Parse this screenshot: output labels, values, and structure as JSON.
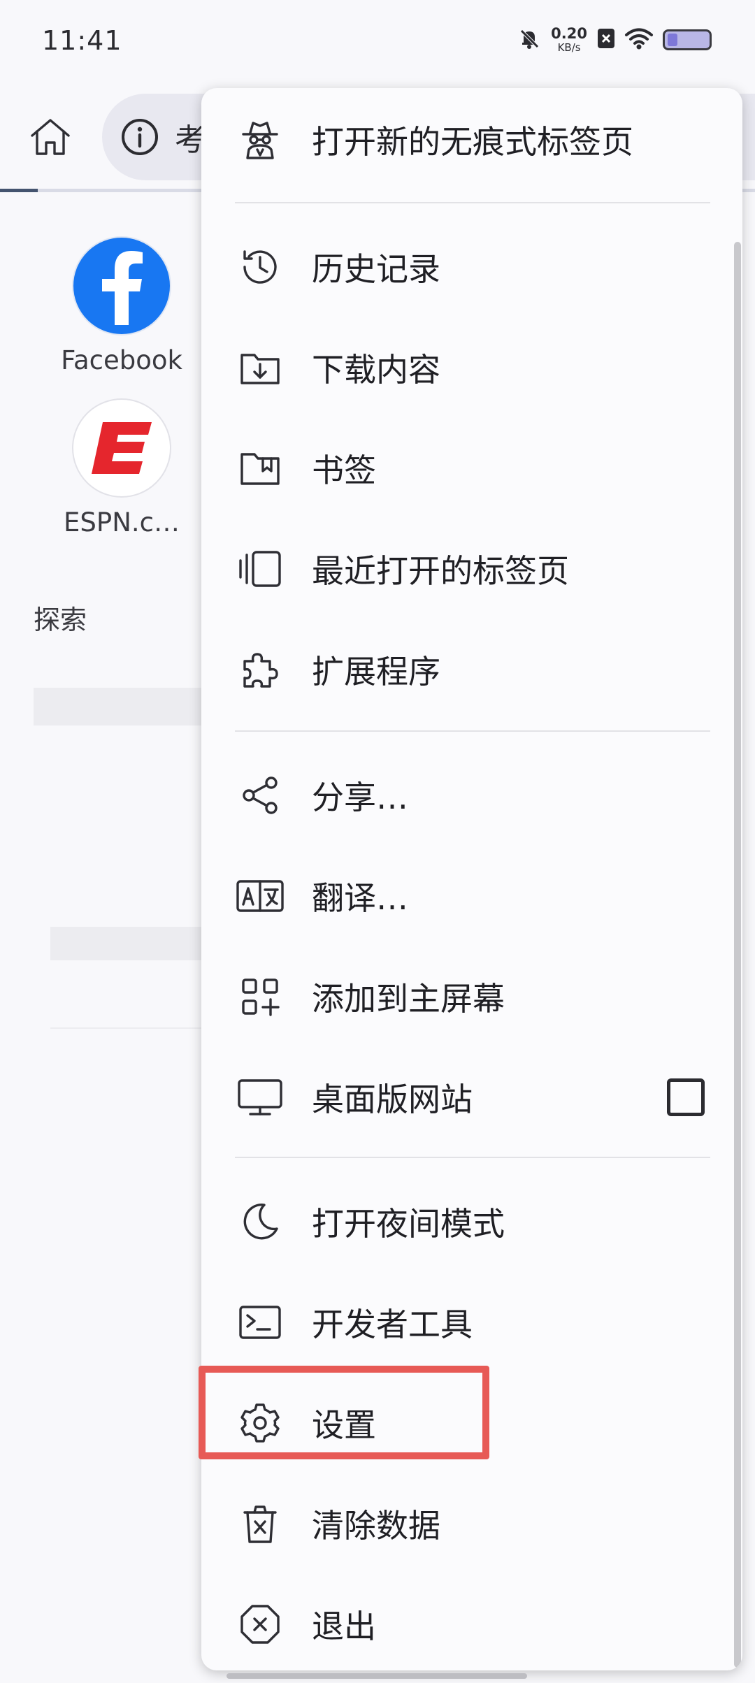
{
  "status_bar": {
    "time": "11:41",
    "net_speed_value": "0.20",
    "net_speed_unit": "KB/s"
  },
  "toolbar": {
    "url_text": "考"
  },
  "shortcuts": [
    {
      "label": "Facebook"
    },
    {
      "label": "ESPN.c…"
    }
  ],
  "page": {
    "explore_heading": "探索"
  },
  "menu": {
    "items": [
      {
        "label": "打开新的无痕式标签页",
        "icon": "incognito-icon"
      },
      {
        "label": "历史记录",
        "icon": "history-icon"
      },
      {
        "label": "下载内容",
        "icon": "download-folder-icon"
      },
      {
        "label": "书签",
        "icon": "bookmark-folder-icon"
      },
      {
        "label": "最近打开的标签页",
        "icon": "recent-tabs-icon"
      },
      {
        "label": "扩展程序",
        "icon": "puzzle-icon"
      },
      {
        "label": "分享…",
        "icon": "share-icon"
      },
      {
        "label": "翻译…",
        "icon": "translate-icon"
      },
      {
        "label": "添加到主屏幕",
        "icon": "add-to-homescreen-icon"
      },
      {
        "label": "桌面版网站",
        "icon": "desktop-icon",
        "checked": false
      },
      {
        "label": "打开夜间模式",
        "icon": "moon-icon"
      },
      {
        "label": "开发者工具",
        "icon": "terminal-icon"
      },
      {
        "label": "设置",
        "icon": "gear-icon",
        "highlighted": true
      },
      {
        "label": "清除数据",
        "icon": "trash-icon"
      },
      {
        "label": "退出",
        "icon": "exit-icon"
      }
    ]
  },
  "colors": {
    "highlight": "#e75a56",
    "facebook_blue": "#1877f2",
    "espn_red": "#e5262d"
  }
}
